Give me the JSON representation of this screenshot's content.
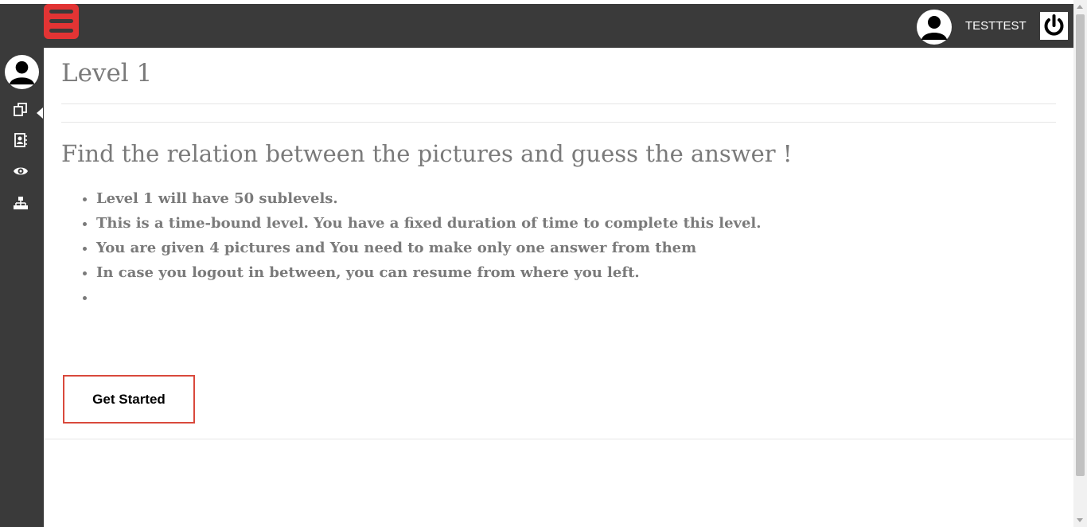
{
  "header": {
    "menu_icon": "hamburger-menu-icon",
    "accent_color": "#e23434",
    "username": "TESTTEST",
    "avatar_icon": "user-avatar-icon",
    "power_icon": "power-icon"
  },
  "sidebar": {
    "avatar_icon": "user-avatar-icon",
    "items": [
      {
        "icon": "copy-icon",
        "active": true
      },
      {
        "icon": "contact-book-icon",
        "active": false
      },
      {
        "icon": "eye-icon",
        "active": false
      },
      {
        "icon": "sitemap-icon",
        "active": false
      }
    ]
  },
  "main": {
    "title": "Level 1",
    "subtitle": "Find the relation between the pictures and guess the answer !",
    "rules": [
      "Level 1 will have 50 sublevels.",
      "This is a time-bound level. You have a fixed duration of time to complete this level.",
      "You are given 4 pictures and You need to make only one answer from them",
      "In case you logout in between, you can resume from where you left.",
      ""
    ],
    "start_button_label": "Get Started",
    "start_button_border_color": "#d9493c"
  }
}
